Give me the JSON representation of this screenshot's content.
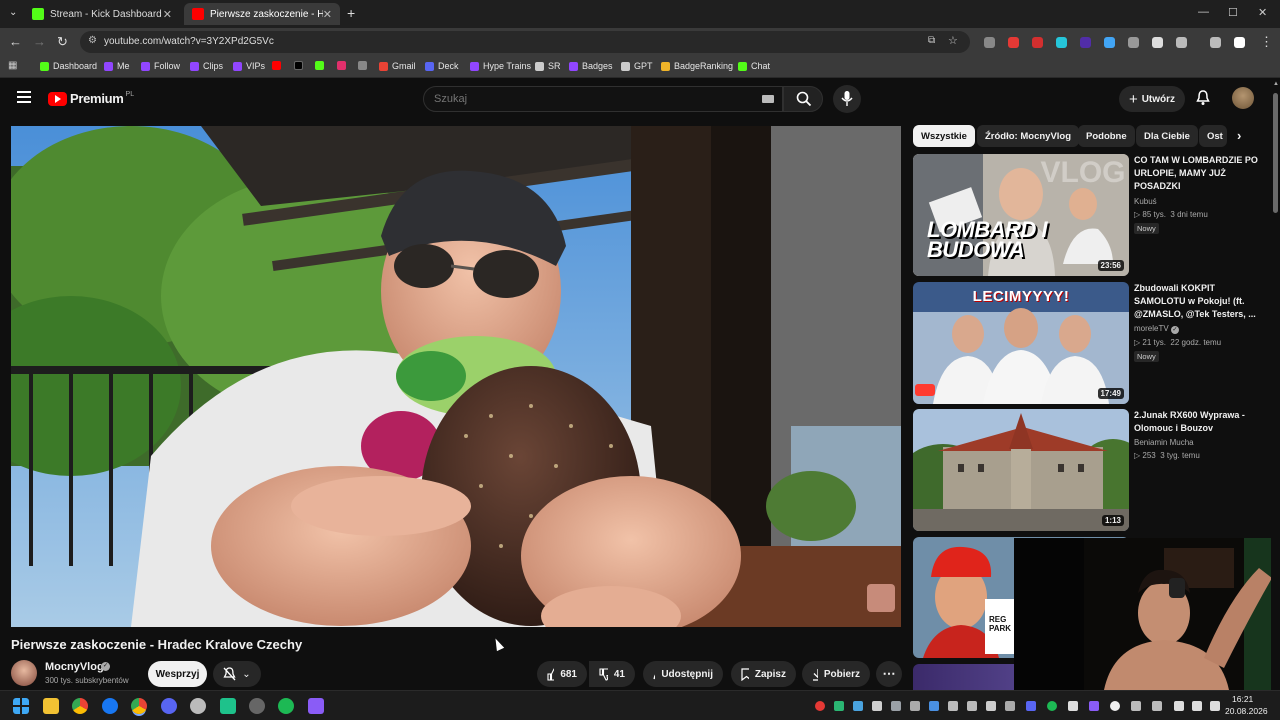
{
  "browser": {
    "tabs": [
      {
        "title": "Stream - Kick Dashboard",
        "favicon_color": "#53fc18"
      },
      {
        "title": "Pierwsze zaskoczenie - Hradec",
        "favicon_color": "#ff0000"
      }
    ],
    "new_tab": "+",
    "url": "youtube.com/watch?v=3Y2XPd2G5Vc",
    "window_controls": {
      "minimize": "—",
      "maximize": "☐",
      "close": "✕"
    }
  },
  "bookmarks": [
    {
      "label": "Dashboard",
      "color": "#53fc18"
    },
    {
      "label": "Me",
      "color": "#9146ff"
    },
    {
      "label": "Follow",
      "color": "#9146ff"
    },
    {
      "label": "Clips",
      "color": "#9146ff"
    },
    {
      "label": "VIPs",
      "color": "#9146ff"
    },
    {
      "label": "",
      "color": "#ff0000"
    },
    {
      "label": "",
      "color": "#000000"
    },
    {
      "label": "",
      "color": "#53fc18"
    },
    {
      "label": "",
      "color": "#e1306c"
    },
    {
      "label": "",
      "color": "#888888"
    },
    {
      "label": "Gmail",
      "color": "#ea4335"
    },
    {
      "label": "Deck",
      "color": "#5865f2"
    },
    {
      "label": "Hype Trains",
      "color": "#9146ff"
    },
    {
      "label": "SR",
      "color": "#cccccc"
    },
    {
      "label": "Badges",
      "color": "#9146ff"
    },
    {
      "label": "GPT",
      "color": "#cccccc"
    },
    {
      "label": "BadgeRanking",
      "color": "#f0b429"
    },
    {
      "label": "Chat",
      "color": "#53fc18"
    }
  ],
  "youtube": {
    "logo_text": "Premium",
    "logo_sup": "PL",
    "search_placeholder": "Szukaj",
    "create_label": "Utwórz"
  },
  "video": {
    "title": "Pierwsze zaskoczenie - Hradec Kralove Czechy",
    "channel": "MocnyVlog",
    "subscribers": "300 tys. subskrybentów",
    "support_label": "Wesprzyj",
    "likes": "681",
    "dislikes": "41",
    "share_label": "Udostępnij",
    "save_label": "Zapisz",
    "download_label": "Pobierz"
  },
  "filter_chips": [
    "Wszystkie",
    "Źródło: MocnyVlog",
    "Podobne",
    "Dla Ciebie",
    "Ost"
  ],
  "recommendations": [
    {
      "title": "CO TAM W LOMBARDZIE PO URLOPIE, MAMY JUŻ POSADZKI",
      "channel": "Kubuś",
      "views": "85 tys.",
      "age": "3 dni temu",
      "badge": "Nowy",
      "duration": "23:56",
      "thumb_text": "LOMBARD I BUDOWA"
    },
    {
      "title": "Zbudowali KOKPIT SAMOLOTU w Pokoju! (ft. @ZMASLO, @Tek Testers, ...",
      "channel": "moreleTV",
      "views": "21 tys.",
      "age": "22 godz. temu",
      "badge": "Nowy",
      "duration": "17:49",
      "thumb_text": "LECIMYYYY!"
    },
    {
      "title": "2.Junak RX600 Wyprawa - Olomouc i Bouzov",
      "channel": "Beniamin Mucha",
      "views": "253",
      "age": "3 tyg. temu",
      "badge": "",
      "duration": "1:13",
      "thumb_text": ""
    },
    {
      "title": "",
      "channel": "",
      "views": "",
      "age": "",
      "badge": "",
      "duration": "",
      "thumb_text": "REG PARK"
    }
  ],
  "taskbar": {
    "time": "16:21",
    "date": "20.08.2026"
  }
}
